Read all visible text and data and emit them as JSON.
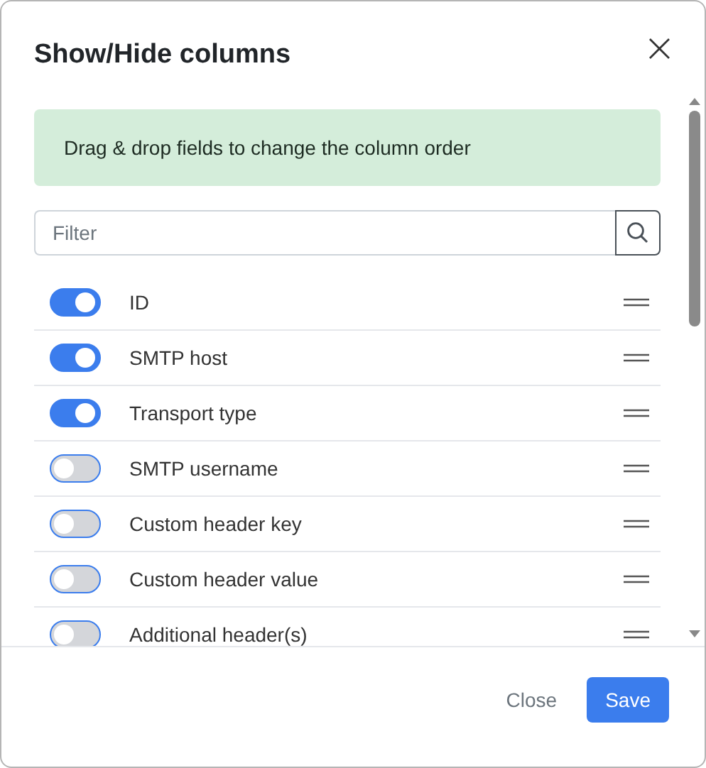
{
  "dialog": {
    "title": "Show/Hide columns",
    "close_label": "×"
  },
  "info": "Drag & drop fields to change the column order",
  "filter": {
    "placeholder": "Filter"
  },
  "columns": [
    {
      "label": "ID",
      "on": true
    },
    {
      "label": "SMTP host",
      "on": true
    },
    {
      "label": "Transport type",
      "on": true
    },
    {
      "label": "SMTP username",
      "on": false
    },
    {
      "label": "Custom header key",
      "on": false
    },
    {
      "label": "Custom header value",
      "on": false
    },
    {
      "label": "Additional header(s)",
      "on": false
    }
  ],
  "buttons": [
    {
      "label": "Close",
      "kind": "secondary"
    },
    {
      "label": "Save",
      "kind": "primary"
    }
  ]
}
